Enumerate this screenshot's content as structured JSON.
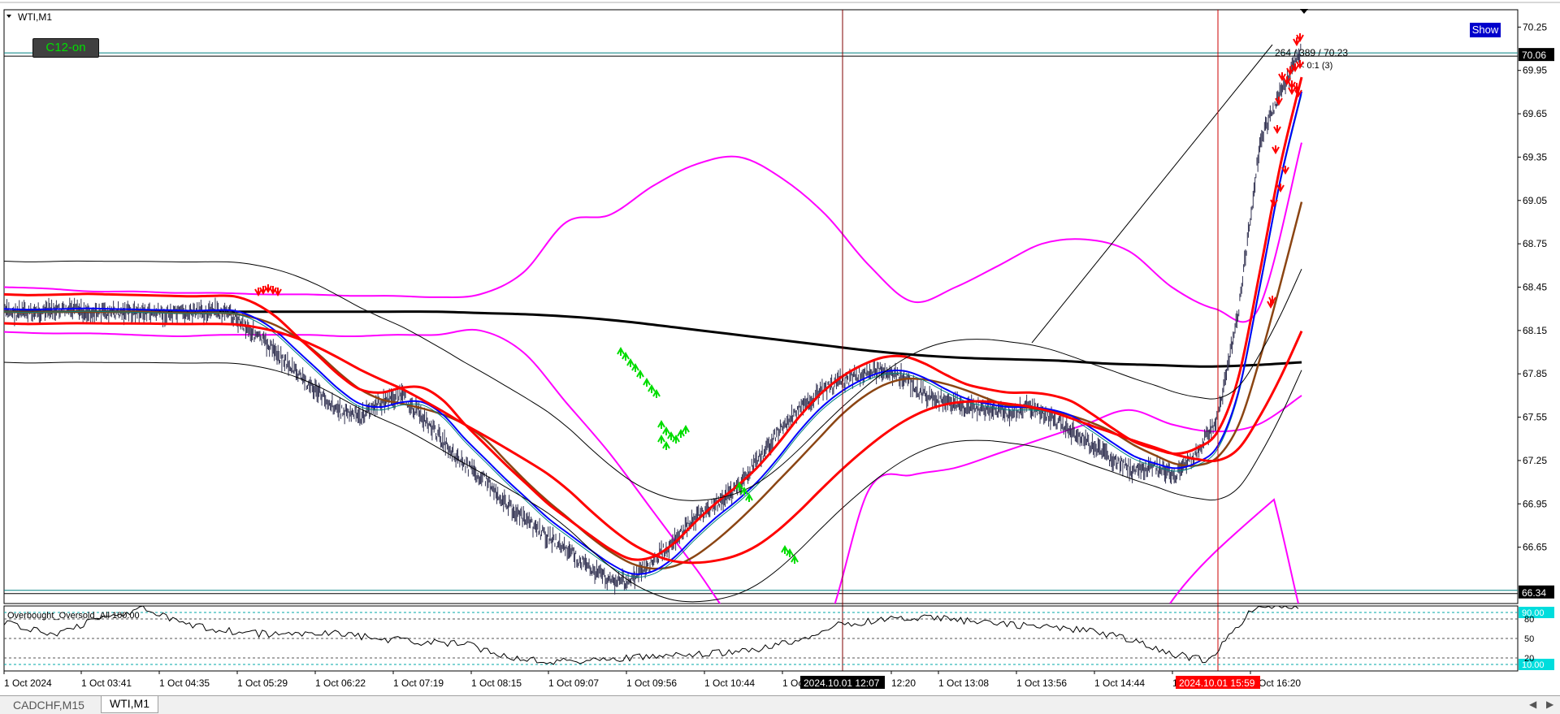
{
  "window": {
    "symbol_title": "WTI,M1"
  },
  "buttons": {
    "c12": "C12-on",
    "show": "Show"
  },
  "tabs": [
    {
      "label": "CADCHF,M15",
      "active": false
    },
    {
      "label": "WTI,M1",
      "active": true
    }
  ],
  "annotations": {
    "trendline_label": "264 / 389 / 70.23",
    "trendline_sub": "< 0:1 (3)"
  },
  "price_labels": {
    "top_line": "70.06",
    "bottom_line": "66.34"
  },
  "oscillator": {
    "name": "Overbought_Oversold_All 100.00",
    "upper_level_label": "90.00",
    "lower_level_label": "10.00",
    "mid_label": "50",
    "level_20": "20",
    "level_80": "80"
  },
  "vlines": [
    {
      "label": "2024.10.01 12:07",
      "color": "#800000"
    },
    {
      "label": "2024.10.01 15:59",
      "color": "#cc0000"
    }
  ],
  "colors": {
    "magenta": "#ff00ff",
    "red": "#ff0000",
    "blue": "#0000ff",
    "brown": "#8b4513",
    "black": "#000000",
    "green": "#00dd00",
    "teal": "#008080",
    "cyan": "#00cccc",
    "price_bars": "#303050"
  },
  "chart_data": {
    "type": "line",
    "title": "WTI,M1",
    "y_axis": {
      "ticks": [
        70.25,
        69.95,
        69.65,
        69.35,
        69.05,
        68.75,
        68.45,
        68.15,
        67.85,
        67.55,
        67.25,
        66.95,
        66.65
      ],
      "tick_labels": [
        "70.25",
        "69.95",
        "69.65",
        "69.35",
        "69.05",
        "68.75",
        "68.45",
        "68.15",
        "67.85",
        "67.55",
        "67.25",
        "66.95",
        "66.65"
      ],
      "range": [
        66.26,
        70.37
      ]
    },
    "x_axis": {
      "tick_labels": [
        "1 Oct 2024",
        "1 Oct 03:41",
        "1 Oct 04:35",
        "1 Oct 05:29",
        "1 Oct 06:22",
        "1 Oct 07:19",
        "1 Oct 08:15",
        "1 Oct 09:07",
        "1 Oct 09:56",
        "1 Oct 10:44",
        "1 Oct 11:33",
        "12:20",
        "1 Oct 13:08",
        "1 Oct 13:56",
        "1 Oct 14:44",
        "1 Oct 15:32",
        "1 Oct 16:20"
      ]
    },
    "horizontal_lines": [
      70.06,
      66.34
    ],
    "series": [
      {
        "name": "price",
        "values": [
          68.28,
          68.27,
          68.28,
          68.29,
          68.28,
          68.27,
          68.28,
          68.27,
          68.26,
          68.27,
          68.28,
          68.25,
          68.12,
          68.0,
          67.85,
          67.72,
          67.6,
          67.55,
          67.65,
          67.7,
          67.55,
          67.38,
          67.22,
          67.12,
          66.95,
          66.82,
          66.72,
          66.62,
          66.5,
          66.42,
          66.42,
          66.55,
          66.7,
          66.85,
          66.95,
          67.05,
          67.25,
          67.45,
          67.6,
          67.72,
          67.8,
          67.85,
          67.88,
          67.82,
          67.7,
          67.65,
          67.62,
          67.6,
          67.58,
          67.62,
          67.55,
          67.45,
          67.35,
          67.25,
          67.18,
          67.2,
          67.15,
          67.3,
          67.55,
          68.3,
          69.45,
          69.8,
          70.1
        ]
      },
      {
        "name": "ma_black",
        "values": [
          68.28,
          68.28,
          68.28,
          68.28,
          68.28,
          68.28,
          68.28,
          68.28,
          68.28,
          68.28,
          68.27,
          68.26,
          68.24,
          68.21,
          68.17,
          68.13,
          68.09,
          68.05,
          68.01,
          67.98,
          67.96,
          67.95,
          67.94,
          67.92,
          67.91,
          67.9,
          67.91,
          67.93
        ]
      },
      {
        "name": "bb_upper_magenta",
        "values": [
          68.45,
          68.44,
          68.42,
          68.42,
          68.41,
          68.41,
          68.4,
          68.4,
          68.39,
          68.39,
          68.38,
          68.4,
          68.55,
          68.9,
          68.95,
          69.15,
          69.3,
          69.35,
          69.2,
          68.95,
          68.6,
          68.35,
          68.45,
          68.6,
          68.75,
          68.78,
          68.7,
          68.45,
          68.3,
          68.3,
          69.45
        ]
      },
      {
        "name": "bb_lower_magenta",
        "values": [
          68.14,
          68.13,
          68.13,
          68.12,
          68.11,
          68.12,
          68.12,
          68.12,
          68.11,
          68.12,
          68.12,
          68.15,
          68.0,
          67.65,
          67.3,
          66.9,
          66.5,
          66.1,
          66.0,
          66.1,
          67.05,
          67.15,
          67.2,
          67.3,
          67.4,
          67.5,
          67.6,
          67.5,
          67.45,
          67.5,
          67.7
        ]
      },
      {
        "name": "oscillator",
        "values": [
          75,
          55,
          80,
          95,
          70,
          60,
          55,
          60,
          50,
          45,
          40,
          20,
          15,
          18,
          22,
          25,
          30,
          45,
          70,
          80,
          82,
          76,
          70,
          65,
          55,
          30,
          15,
          100,
          100
        ]
      }
    ],
    "markers": {
      "down_arrows_red_count": 24,
      "up_arrows_green_count": 22
    }
  }
}
